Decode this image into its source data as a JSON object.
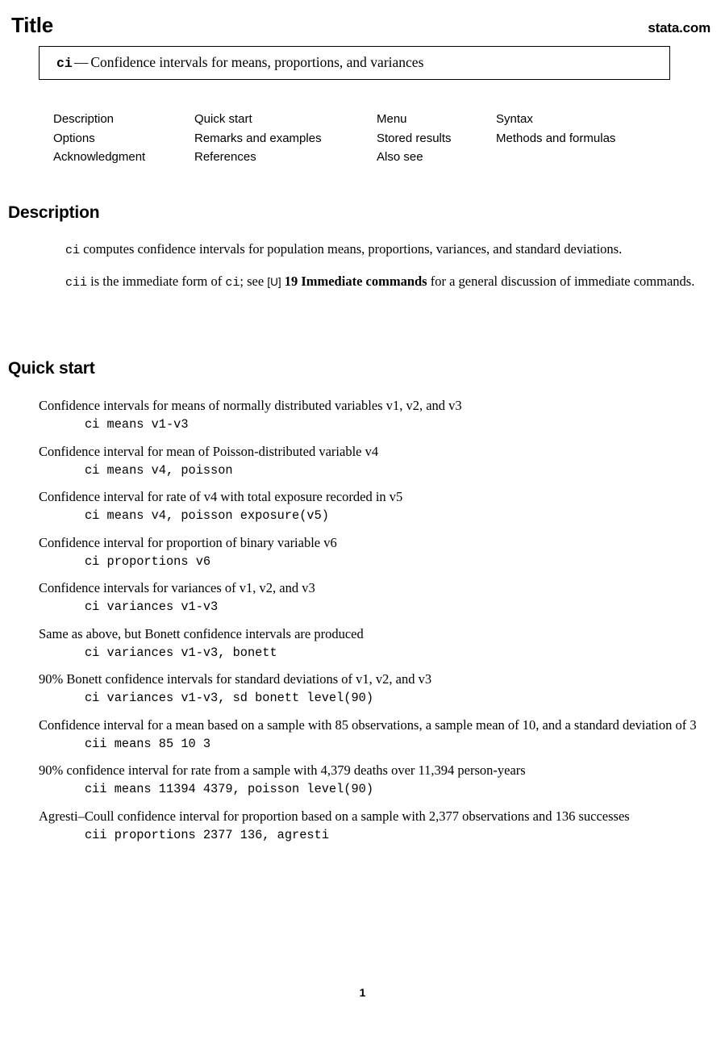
{
  "header": {
    "title_label": "Title",
    "site_label": "stata.com"
  },
  "title_box": {
    "command": "ci",
    "dash": "—",
    "description": "Confidence intervals for means, proportions, and variances"
  },
  "toc": {
    "items": [
      "Description",
      "Quick start",
      "Menu",
      "Syntax",
      "Options",
      "Remarks and examples",
      "Stored results",
      "Methods and formulas",
      "Acknowledgment",
      "References",
      "Also see",
      ""
    ]
  },
  "description": {
    "heading": "Description",
    "para1": {
      "code1": "ci",
      "text1": " computes confidence intervals for population means, proportions, variances, and standard deviations."
    },
    "para2": {
      "code1": "cii",
      "text1": " is the immediate form of ",
      "code2": "ci",
      "text2": "; see ",
      "manual_bracket": "[U]",
      "manual_ref": " 19 Immediate commands",
      "text3": " for a general discussion of immediate commands."
    }
  },
  "quick_start": {
    "heading": "Quick start",
    "items": [
      {
        "desc": "Confidence intervals for means of normally distributed variables v1, v2, and v3",
        "code": "ci means v1-v3"
      },
      {
        "desc": "Confidence interval for mean of Poisson-distributed variable v4",
        "code": "ci means v4, poisson"
      },
      {
        "desc": "Confidence interval for rate of v4 with total exposure recorded in v5",
        "code": "ci means v4, poisson exposure(v5)"
      },
      {
        "desc": "Confidence interval for proportion of binary variable v6",
        "code": "ci proportions v6"
      },
      {
        "desc": "Confidence intervals for variances of v1, v2, and v3",
        "code": "ci variances v1-v3"
      },
      {
        "desc": "Same as above, but Bonett confidence intervals are produced",
        "code": "ci variances v1-v3, bonett"
      },
      {
        "desc": "90% Bonett confidence intervals for standard deviations of v1, v2, and v3",
        "code": "ci variances v1-v3, sd bonett level(90)"
      },
      {
        "desc": "Confidence interval for a mean based on a sample with 85 observations, a sample mean of 10, and a standard deviation of 3",
        "code": "cii means 85 10 3"
      },
      {
        "desc": "90% confidence interval for rate from a sample with 4,379 deaths over 11,394 person-years",
        "code": "cii means 11394 4379, poisson level(90)"
      },
      {
        "desc": "Agresti–Coull confidence interval for proportion based on a sample with 2,377 observations and 136 successes",
        "code": "cii proportions 2377 136, agresti"
      }
    ]
  },
  "footer": {
    "page_number": "1"
  }
}
